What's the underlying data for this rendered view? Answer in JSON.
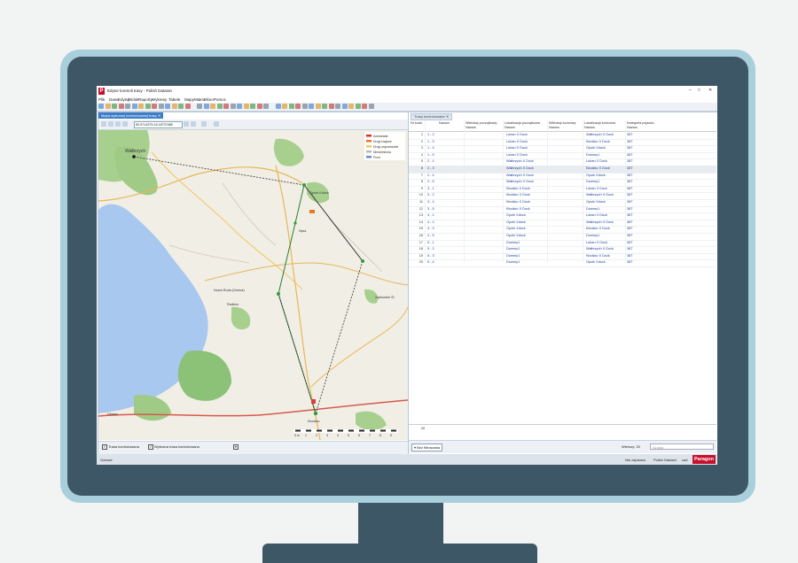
{
  "window": {
    "title": "Edytor kontroli trasy - Polish Dataset"
  },
  "menu": [
    "Plik",
    "Dane",
    "Edytuj",
    "Widok",
    "Raporty",
    "Wykresy",
    "Tabele",
    "Mapy",
    "Makra",
    "Okno",
    "Pomoc"
  ],
  "map_panel": {
    "tab_label": "Mapa wybranej kontrolowanej trasy",
    "coordinates": "50.971437N 16.1873748E",
    "labels": {
      "walbrzych": "Wałbrzych",
      "nowa_ruda": "Nowa Ruda (Gmina)",
      "klodzko": "Kłodzko",
      "opole": "Opole Kdock",
      "ziebice": "Ząbkowice Śl.",
      "nysa": "Nysa",
      "glowno": "Głowno",
      "radkow": "Radków",
      "trasa": "Trasa kontrolowana",
      "wybrana": "Wybrana trasa kontrolowana"
    },
    "legend": [
      "Autostrada",
      "Drogi krajowe",
      "Drogi wojewódzkie",
      "Nieokreślona",
      "Prom"
    ],
    "scale_labels": [
      "0 m",
      "1",
      "2",
      "3",
      "4",
      "5",
      "6",
      "7",
      "8",
      "9"
    ]
  },
  "table_panel": {
    "tab_label": "Trasy kontrolowane",
    "columns": [
      {
        "key": "nr",
        "l1": "Nr kodu",
        "l2": ""
      },
      {
        "key": "nazwa",
        "l1": "Nazwa",
        "l2": ""
      },
      {
        "key": "wk",
        "l1": "Wielokąt początkowy",
        "l2": "Nazwa"
      },
      {
        "key": "lp",
        "l1": "Lokalizacja początkowa",
        "l2": "Nazwa"
      },
      {
        "key": "wkk",
        "l1": "Wielokąt końcowy",
        "l2": "Nazwa"
      },
      {
        "key": "lk",
        "l1": "Lokalizacja końcowa",
        "l2": "Nazwa"
      },
      {
        "key": "kp",
        "l1": "Kategoria pojazdu",
        "l2": "Nazwa"
      }
    ],
    "rows": [
      {
        "nr": "1",
        "nazwa": "1 - 2",
        "lp": "Luban X Dock",
        "lk": "Wałbrzych X Dock",
        "kp": "38T"
      },
      {
        "nr": "2",
        "nazwa": "1 - 3",
        "lp": "Luban X Dock",
        "lk": "Kłodzko X Dock",
        "kp": "38T"
      },
      {
        "nr": "3",
        "nazwa": "1 - 4",
        "lp": "Luban X Dock",
        "lk": "Opole Xdock",
        "kp": "38T"
      },
      {
        "nr": "4",
        "nazwa": "1 - 5",
        "lp": "Luban X Dock",
        "lk": "Dummy1",
        "kp": "38T"
      },
      {
        "nr": "5",
        "nazwa": "2 - 1",
        "lp": "Wałbrzych X Dock",
        "lk": "Luban X Dock",
        "kp": "38T"
      },
      {
        "nr": "6",
        "nazwa": "2 - 3",
        "lp": "Wałbrzych X Dock",
        "lk": "Kłodzko X Dock",
        "kp": "38T"
      },
      {
        "nr": "7",
        "nazwa": "2 - 4",
        "lp": "Wałbrzych X Dock",
        "lk": "Opole Xdock",
        "kp": "38T"
      },
      {
        "nr": "8",
        "nazwa": "2 - 5",
        "lp": "Wałbrzych X Dock",
        "lk": "Dummy1",
        "kp": "38T"
      },
      {
        "nr": "9",
        "nazwa": "3 - 1",
        "lp": "Kłodzko X Dock",
        "lk": "Luban X Dock",
        "kp": "38T"
      },
      {
        "nr": "10",
        "nazwa": "3 - 2",
        "lp": "Kłodzko X Dock",
        "lk": "Wałbrzych X Dock",
        "kp": "38T"
      },
      {
        "nr": "11",
        "nazwa": "3 - 4",
        "lp": "Kłodzko X Dock",
        "lk": "Opole Xdock",
        "kp": "38T"
      },
      {
        "nr": "12",
        "nazwa": "3 - 5",
        "lp": "Kłodzko X Dock",
        "lk": "Dummy1",
        "kp": "38T"
      },
      {
        "nr": "13",
        "nazwa": "4 - 1",
        "lp": "Opole Xdock",
        "lk": "Luban X Dock",
        "kp": "38T"
      },
      {
        "nr": "14",
        "nazwa": "4 - 2",
        "lp": "Opole Xdock",
        "lk": "Wałbrzych X Dock",
        "kp": "38T"
      },
      {
        "nr": "15",
        "nazwa": "4 - 3",
        "lp": "Opole Xdock",
        "lk": "Kłodzko X Dock",
        "kp": "38T"
      },
      {
        "nr": "16",
        "nazwa": "4 - 5",
        "lp": "Opole Xdock",
        "lk": "Dummy1",
        "kp": "38T"
      },
      {
        "nr": "17",
        "nazwa": "5 - 1",
        "lp": "Dummy1",
        "lk": "Luban X Dock",
        "kp": "38T"
      },
      {
        "nr": "18",
        "nazwa": "5 - 2",
        "lp": "Dummy1",
        "lk": "Wałbrzych X Dock",
        "kp": "38T"
      },
      {
        "nr": "19",
        "nazwa": "5 - 3",
        "lp": "Dummy1",
        "lk": "Kłodzko X Dock",
        "kp": "38T"
      },
      {
        "nr": "20",
        "nazwa": "5 - 4",
        "lp": "Dummy1",
        "lk": "Opole Xdock",
        "kp": "38T"
      }
    ],
    "selected_row": 6,
    "footer_count": "20",
    "filter_label": "Bez filtrowania",
    "rows_label": "Wierszy: 20",
    "search_placeholder": "Szukaj"
  },
  "status": {
    "left": "Gotowe",
    "unsaved": "Nie zapisano",
    "dataset": "Polish Dataset",
    "last": "cad",
    "brand": "Paragon"
  },
  "colors": {
    "accent": "#3b7dc7",
    "brand": "#c8102e",
    "bezel": "#3e5766",
    "frame": "#a8cfdb"
  }
}
